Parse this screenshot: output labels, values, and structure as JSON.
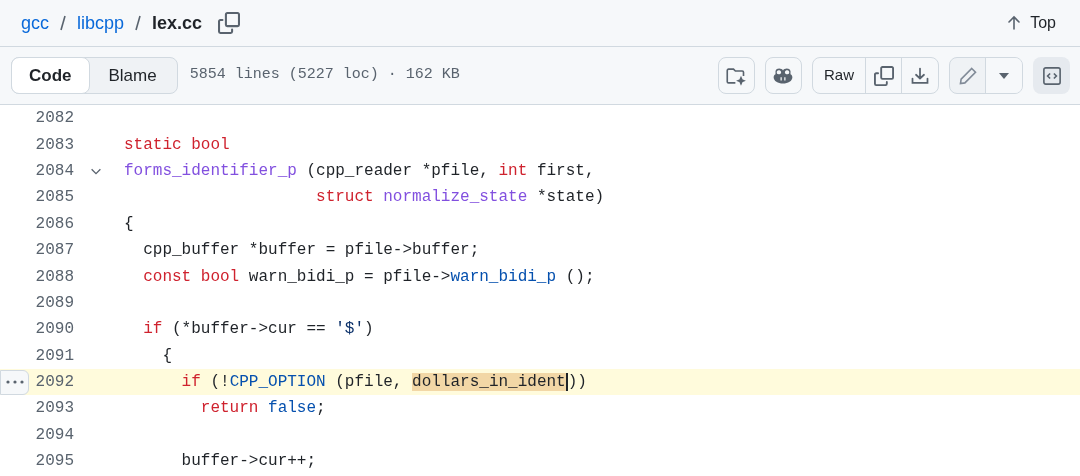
{
  "breadcrumb": [
    {
      "label": "gcc",
      "kind": "link"
    },
    {
      "label": "libcpp",
      "kind": "link"
    },
    {
      "label": "lex.cc",
      "kind": "current"
    }
  ],
  "top_link": {
    "label": "Top"
  },
  "view_tabs": [
    {
      "label": "Code",
      "selected": true
    },
    {
      "label": "Blame",
      "selected": false
    }
  ],
  "file_info": "5854 lines (5227 loc) · 162 KB",
  "raw_button": {
    "label": "Raw"
  },
  "code_lines": [
    {
      "number": "2082",
      "highlighted": false
    },
    {
      "number": "2083",
      "tokens": [
        {
          "kind": "keyword",
          "text": "static bool"
        }
      ],
      "highlighted": false
    },
    {
      "number": "2084",
      "fold_toggle": {
        "expanded": true
      },
      "tokens": [
        {
          "kind": "function",
          "text": "forms_identifier_p"
        },
        {
          "kind": "plain",
          "text": " (cpp_reader *pfile, "
        },
        {
          "kind": "keyword",
          "text": "int"
        },
        {
          "kind": "plain",
          "text": " first,"
        }
      ],
      "highlighted": false
    },
    {
      "number": "2085",
      "tokens": [
        {
          "kind": "keyword",
          "text": "                    struct "
        },
        {
          "kind": "function",
          "text": "normalize_state"
        },
        {
          "kind": "plain",
          "text": " *state)"
        }
      ],
      "highlighted": false
    },
    {
      "number": "2086",
      "tokens": [
        {
          "kind": "plain",
          "text": "{"
        }
      ],
      "highlighted": false
    },
    {
      "number": "2087",
      "tokens": [
        {
          "kind": "plain",
          "text": "  cpp_buffer *buffer = pfile->buffer;"
        }
      ],
      "highlighted": false
    },
    {
      "number": "2088",
      "tokens": [
        {
          "kind": "keyword",
          "text": "  const bool"
        },
        {
          "kind": "plain",
          "text": " warn_bidi_p = pfile->"
        },
        {
          "kind": "constant",
          "text": "warn_bidi_p"
        },
        {
          "kind": "plain",
          "text": " ();"
        }
      ],
      "highlighted": false
    },
    {
      "number": "2089",
      "highlighted": false
    },
    {
      "number": "2090",
      "tokens": [
        {
          "kind": "keyword",
          "text": "  if"
        },
        {
          "kind": "plain",
          "text": " (*buffer->cur == "
        },
        {
          "kind": "string",
          "text": "'$'"
        },
        {
          "kind": "plain",
          "text": ")"
        }
      ],
      "highlighted": false
    },
    {
      "number": "2091",
      "tokens": [
        {
          "kind": "plain",
          "text": "    {"
        }
      ],
      "highlighted": false
    },
    {
      "number": "2092",
      "tokens": [
        {
          "kind": "keyword",
          "text": "      if"
        },
        {
          "kind": "plain",
          "text": " (!"
        },
        {
          "kind": "constant",
          "text": "CPP_OPTION"
        },
        {
          "kind": "plain",
          "text": " (pfile, "
        },
        {
          "kind": "selection",
          "text": "dollars_in_ident"
        },
        {
          "kind": "plain",
          "text": "))"
        }
      ],
      "highlighted": true
    },
    {
      "number": "2093",
      "tokens": [
        {
          "kind": "keyword",
          "text": "        return"
        },
        {
          "kind": "constant",
          "text": " false"
        },
        {
          "kind": "plain",
          "text": ";"
        }
      ],
      "highlighted": false
    },
    {
      "number": "2094",
      "highlighted": false
    },
    {
      "number": "2095",
      "tokens": [
        {
          "kind": "plain",
          "text": "      buffer->cur++;"
        }
      ],
      "highlighted": false
    }
  ]
}
